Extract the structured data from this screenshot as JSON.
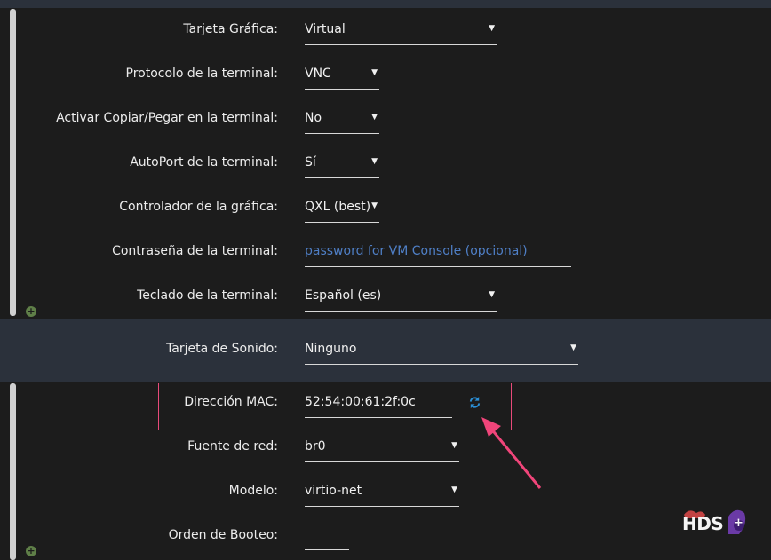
{
  "section_video": {
    "rows": [
      {
        "label": "Tarjeta Gráfica:",
        "value": "Virtual"
      },
      {
        "label": "Protocolo de la terminal:",
        "value": "VNC"
      },
      {
        "label": "Activar Copiar/Pegar en la terminal:",
        "value": "No"
      },
      {
        "label": "AutoPort de la terminal:",
        "value": "Sí"
      },
      {
        "label": "Controlador de la gráfica:",
        "value": "QXL (best)"
      },
      {
        "label": "Contraseña de la terminal:",
        "placeholder": "password for VM Console (opcional)"
      },
      {
        "label": "Teclado de la terminal:",
        "value": "Español (es)"
      }
    ]
  },
  "section_sound": {
    "label": "Tarjeta de Sonido:",
    "value": "Ninguno"
  },
  "section_network": {
    "rows": [
      {
        "label": "Dirección MAC:",
        "value": "52:54:00:61:2f:0c"
      },
      {
        "label": "Fuente de red:",
        "value": "br0"
      },
      {
        "label": "Modelo:",
        "value": "virtio-net"
      },
      {
        "label": "Orden de Booteo:",
        "value": ""
      }
    ]
  },
  "icons": {
    "add": "plus-circle-icon",
    "refresh": "refresh-icon",
    "dropdown": "caret-down-icon"
  },
  "colors": {
    "accent_link": "#4f7fc6",
    "highlight_border": "#e84a7a",
    "add_icon": "#5f7f48",
    "refresh_icon": "#2b8fd6"
  },
  "watermark": {
    "text": "HDS"
  }
}
